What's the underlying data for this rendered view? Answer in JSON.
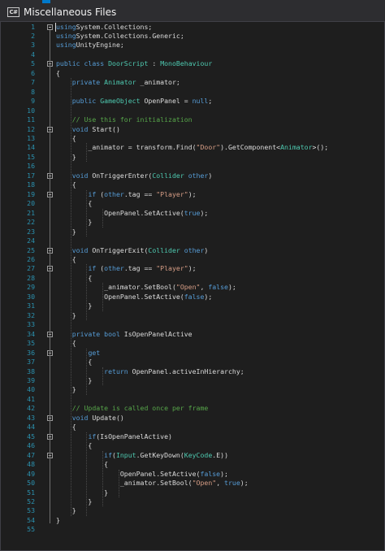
{
  "window": {
    "title": "Miscellaneous Files",
    "file_icon_label": "C#"
  },
  "editor": {
    "lines": [
      {
        "n": "1",
        "t": [
          [
            "kw",
            "using"
          ],
          [
            "",
            "System.Collections;"
          ]
        ]
      },
      {
        "n": "2",
        "t": [
          [
            "kw",
            "using"
          ],
          [
            "",
            "System.Collections.Generic;"
          ]
        ]
      },
      {
        "n": "3",
        "t": [
          [
            "kw",
            "using"
          ],
          [
            "",
            "UnityEngine;"
          ]
        ]
      },
      {
        "n": "4",
        "t": []
      },
      {
        "n": "5",
        "t": [
          [
            "kw",
            "public class"
          ],
          [
            "ty",
            "DoorScript"
          ],
          [
            "",
            " : "
          ],
          [
            "ty",
            "MonoBehaviour"
          ]
        ]
      },
      {
        "n": "6",
        "t": [
          [
            "",
            "{"
          ]
        ]
      },
      {
        "n": "7",
        "t": [
          [
            "",
            "    "
          ],
          [
            "kw",
            "private"
          ],
          [
            "",
            " "
          ],
          [
            "ty",
            "Animator"
          ],
          [
            "",
            " _animator;"
          ]
        ]
      },
      {
        "n": "8",
        "t": []
      },
      {
        "n": "9",
        "t": [
          [
            "",
            "    "
          ],
          [
            "kw",
            "public"
          ],
          [
            "",
            " "
          ],
          [
            "ty",
            "GameObject"
          ],
          [
            "",
            " OpenPanel = "
          ],
          [
            "kw",
            "null"
          ],
          [
            "",
            ";"
          ]
        ]
      },
      {
        "n": "10",
        "t": []
      },
      {
        "n": "11",
        "t": [
          [
            "",
            "    "
          ],
          [
            "cm",
            "// Use this for initialization"
          ]
        ]
      },
      {
        "n": "12",
        "t": [
          [
            "",
            "    "
          ],
          [
            "kw",
            "void"
          ],
          [
            "",
            " Start()"
          ]
        ]
      },
      {
        "n": "13",
        "t": [
          [
            "",
            "    {"
          ]
        ]
      },
      {
        "n": "14",
        "t": [
          [
            "",
            "        _animator = transform.Find("
          ],
          [
            "st",
            "\"Door\""
          ],
          [
            "",
            ").GetComponent<"
          ],
          [
            "ty",
            "Animator"
          ],
          [
            "",
            ">();"
          ]
        ]
      },
      {
        "n": "15",
        "t": [
          [
            "",
            "    }"
          ]
        ]
      },
      {
        "n": "16",
        "t": []
      },
      {
        "n": "17",
        "t": [
          [
            "",
            "    "
          ],
          [
            "kw",
            "void"
          ],
          [
            "",
            " OnTriggerEnter("
          ],
          [
            "ty",
            "Collider"
          ],
          [
            "",
            " "
          ],
          [
            "kw",
            "other"
          ],
          [
            "",
            ")"
          ]
        ]
      },
      {
        "n": "18",
        "t": [
          [
            "",
            "    {"
          ]
        ]
      },
      {
        "n": "19",
        "t": [
          [
            "",
            "        "
          ],
          [
            "kw",
            "if"
          ],
          [
            "",
            " ("
          ],
          [
            "kw",
            "other"
          ],
          [
            "",
            ".tag == "
          ],
          [
            "st",
            "\"Player\""
          ],
          [
            "",
            ");"
          ]
        ]
      },
      {
        "n": "20",
        "t": [
          [
            "",
            "        {"
          ]
        ]
      },
      {
        "n": "21",
        "t": [
          [
            "",
            "            OpenPanel.SetActive("
          ],
          [
            "kw",
            "true"
          ],
          [
            "",
            ");"
          ]
        ]
      },
      {
        "n": "22",
        "t": [
          [
            "",
            "        }"
          ]
        ]
      },
      {
        "n": "23",
        "t": [
          [
            "",
            "    }"
          ]
        ]
      },
      {
        "n": "24",
        "t": []
      },
      {
        "n": "25",
        "t": [
          [
            "",
            "    "
          ],
          [
            "kw",
            "void"
          ],
          [
            "",
            " OnTriggerExit("
          ],
          [
            "ty",
            "Collider"
          ],
          [
            "",
            " "
          ],
          [
            "kw",
            "other"
          ],
          [
            "",
            ")"
          ]
        ]
      },
      {
        "n": "26",
        "t": [
          [
            "",
            "    {"
          ]
        ]
      },
      {
        "n": "27",
        "t": [
          [
            "",
            "        "
          ],
          [
            "kw",
            "if"
          ],
          [
            "",
            " ("
          ],
          [
            "kw",
            "other"
          ],
          [
            "",
            ".tag == "
          ],
          [
            "st",
            "\"Player\""
          ],
          [
            "",
            ");"
          ]
        ]
      },
      {
        "n": "28",
        "t": [
          [
            "",
            "        {"
          ]
        ]
      },
      {
        "n": "29",
        "t": [
          [
            "",
            "            _animator.SetBool("
          ],
          [
            "st",
            "\"Open\""
          ],
          [
            "",
            ", "
          ],
          [
            "kw",
            "false"
          ],
          [
            "",
            ");"
          ]
        ]
      },
      {
        "n": "30",
        "t": [
          [
            "",
            "            OpenPanel.SetActive("
          ],
          [
            "kw",
            "false"
          ],
          [
            "",
            ");"
          ]
        ]
      },
      {
        "n": "31",
        "t": [
          [
            "",
            "        }"
          ]
        ]
      },
      {
        "n": "32",
        "t": [
          [
            "",
            "    }"
          ]
        ]
      },
      {
        "n": "33",
        "t": []
      },
      {
        "n": "34",
        "t": [
          [
            "",
            "    "
          ],
          [
            "kw",
            "private bool"
          ],
          [
            "",
            " IsOpenPanelActive"
          ]
        ]
      },
      {
        "n": "35",
        "t": [
          [
            "",
            "    {"
          ]
        ]
      },
      {
        "n": "36",
        "t": [
          [
            "",
            "        "
          ],
          [
            "kw",
            "get"
          ]
        ]
      },
      {
        "n": "37",
        "t": [
          [
            "",
            "        {"
          ]
        ]
      },
      {
        "n": "38",
        "t": [
          [
            "",
            "            "
          ],
          [
            "kw",
            "return"
          ],
          [
            "",
            " OpenPanel.activeInHierarchy;"
          ]
        ]
      },
      {
        "n": "39",
        "t": [
          [
            "",
            "        }"
          ]
        ]
      },
      {
        "n": "40",
        "t": [
          [
            "",
            "    }"
          ]
        ]
      },
      {
        "n": "41",
        "t": []
      },
      {
        "n": "42",
        "t": [
          [
            "",
            "    "
          ],
          [
            "cm",
            "// Update is called once per frame"
          ]
        ]
      },
      {
        "n": "43",
        "t": [
          [
            "",
            "    "
          ],
          [
            "kw",
            "void"
          ],
          [
            "",
            " Update()"
          ]
        ]
      },
      {
        "n": "44",
        "t": [
          [
            "",
            "    {"
          ]
        ]
      },
      {
        "n": "45",
        "t": [
          [
            "",
            "        "
          ],
          [
            "kw",
            "if"
          ],
          [
            "",
            "(IsOpenPanelActive)"
          ]
        ]
      },
      {
        "n": "46",
        "t": [
          [
            "",
            "        {"
          ]
        ]
      },
      {
        "n": "47",
        "t": [
          [
            "",
            "            "
          ],
          [
            "kw",
            "if"
          ],
          [
            "",
            "("
          ],
          [
            "ty",
            "Input"
          ],
          [
            "",
            ".GetKeyDown("
          ],
          [
            "ty",
            "KeyCode"
          ],
          [
            "",
            ".E))"
          ]
        ]
      },
      {
        "n": "48",
        "t": [
          [
            "",
            "            {"
          ]
        ]
      },
      {
        "n": "49",
        "t": [
          [
            "",
            "                OpenPanel.SetActive("
          ],
          [
            "kw",
            "false"
          ],
          [
            "",
            ");"
          ]
        ]
      },
      {
        "n": "50",
        "t": [
          [
            "",
            "                _animator.SetBool("
          ],
          [
            "st",
            "\"Open\""
          ],
          [
            "",
            ", "
          ],
          [
            "kw",
            "true"
          ],
          [
            "",
            ");"
          ]
        ]
      },
      {
        "n": "51",
        "t": [
          [
            "",
            "            }"
          ]
        ]
      },
      {
        "n": "52",
        "t": [
          [
            "",
            "        }"
          ]
        ]
      },
      {
        "n": "53",
        "t": [
          [
            "",
            "    }"
          ]
        ]
      },
      {
        "n": "54",
        "t": [
          [
            "",
            "}"
          ]
        ]
      },
      {
        "n": "55",
        "t": []
      }
    ]
  }
}
